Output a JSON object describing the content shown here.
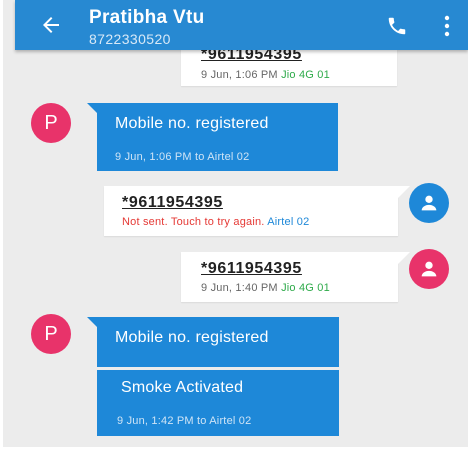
{
  "header": {
    "contact_name": "Pratibha Vtu",
    "contact_number": "8722330520"
  },
  "messages": [
    {
      "number": "*9611954395",
      "time": "9 Jun, 1:06 PM",
      "sim": "Jio 4G 01"
    },
    {
      "avatar_letter": "P",
      "text": "Mobile no. registered",
      "time": "9 Jun, 1:06 PM to Airtel 02"
    },
    {
      "number": "*9611954395",
      "status": "Not sent. Touch to try again.",
      "sim": "Airtel 02"
    },
    {
      "number": "*9611954395",
      "time": "9 Jun, 1:40 PM",
      "sim": "Jio 4G 01"
    },
    {
      "avatar_letter": "P",
      "text": "Mobile no. registered"
    },
    {
      "text": "Smoke Activated",
      "time": "9 Jun, 1:42 PM to Airtel 02"
    }
  ],
  "colors": {
    "appbar": "#2789d2",
    "incoming_bubble": "#1e88d8",
    "contact_avatar": "#e8336a",
    "sim_jio": "#2eaa4a",
    "error": "#e53935"
  },
  "icons": {
    "back": "arrow-left-icon",
    "call": "phone-icon",
    "menu": "more-vertical-icon",
    "person": "person-icon"
  }
}
